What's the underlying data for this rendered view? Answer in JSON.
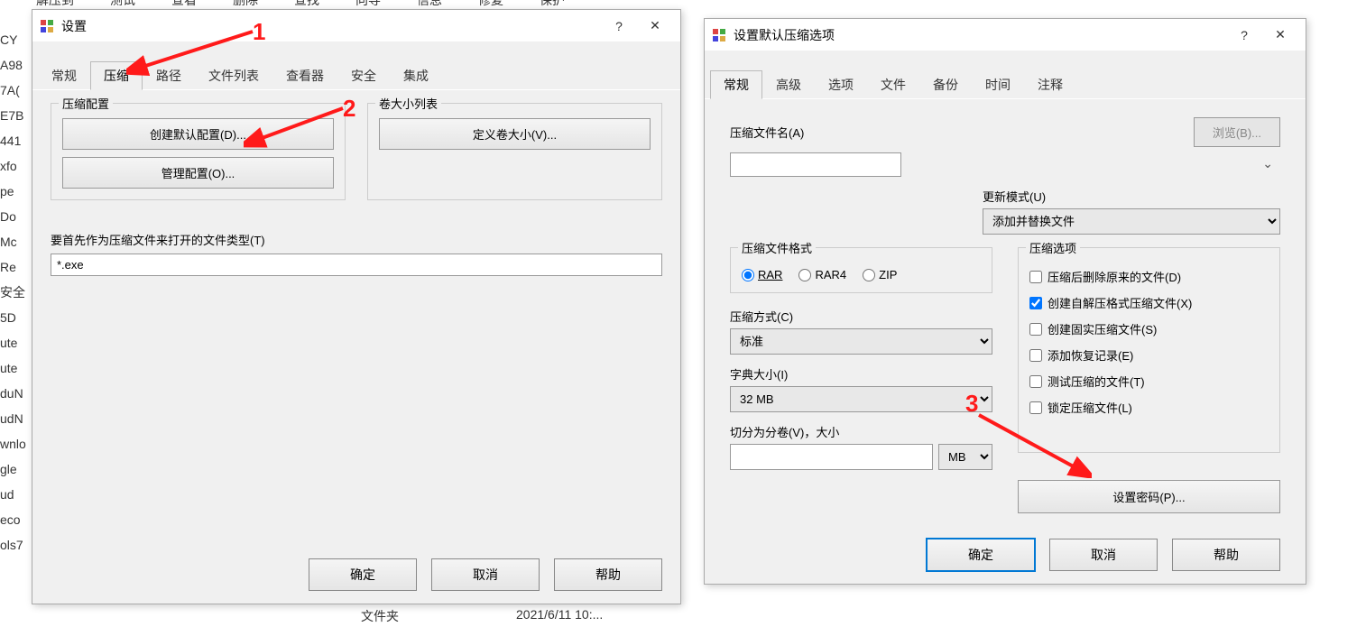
{
  "bg_menu": [
    "解压到",
    "测试",
    "查看",
    "删除",
    "查找",
    "向导",
    "信息",
    "修复",
    "保护"
  ],
  "bg_left": [
    "CY",
    "A98",
    "7A(",
    "E7B",
    "441",
    "xfo",
    "pe",
    "Do",
    "Mc",
    "Re",
    "安全",
    "5D",
    "ute",
    "ute",
    "duN",
    "udN",
    "",
    "wnlo",
    "gle",
    "ud",
    "eco",
    "ols7"
  ],
  "bg_footer": [
    "文件夹",
    "2021/6/11 10:..."
  ],
  "dialog1": {
    "title": "设置",
    "tabs": [
      "常规",
      "压缩",
      "路径",
      "文件列表",
      "查看器",
      "安全",
      "集成"
    ],
    "active_tab": 1,
    "group_profile": "压缩配置",
    "btn_create_default": "创建默认配置(D)...",
    "btn_manage": "管理配置(O)...",
    "group_vol": "卷大小列表",
    "btn_define_vol": "定义卷大小(V)...",
    "label_filetype": "要首先作为压缩文件来打开的文件类型(T)",
    "filetype_value": "*.exe",
    "btn_ok": "确定",
    "btn_cancel": "取消",
    "btn_help": "帮助"
  },
  "dialog2": {
    "title": "设置默认压缩选项",
    "tabs": [
      "常规",
      "高级",
      "选项",
      "文件",
      "备份",
      "时间",
      "注释"
    ],
    "active_tab": 0,
    "label_archive_name": "压缩文件名(A)",
    "btn_browse": "浏览(B)...",
    "label_update_mode": "更新模式(U)",
    "update_mode_value": "添加并替换文件",
    "label_archive_fmt": "压缩文件格式",
    "fmt_options": [
      "RAR",
      "RAR4",
      "ZIP"
    ],
    "fmt_selected": "RAR",
    "label_compress_method": "压缩方式(C)",
    "compress_method_value": "标准",
    "label_dict_size": "字典大小(I)",
    "dict_size_value": "32 MB",
    "label_split_vol": "切分为分卷(V)，大小",
    "split_unit": "MB",
    "label_compress_opts": "压缩选项",
    "checks": [
      {
        "label": "压缩后删除原来的文件(D)",
        "checked": false
      },
      {
        "label": "创建自解压格式压缩文件(X)",
        "checked": true
      },
      {
        "label": "创建固实压缩文件(S)",
        "checked": false
      },
      {
        "label": "添加恢复记录(E)",
        "checked": false
      },
      {
        "label": "测试压缩的文件(T)",
        "checked": false
      },
      {
        "label": "锁定压缩文件(L)",
        "checked": false
      }
    ],
    "btn_set_password": "设置密码(P)...",
    "btn_ok": "确定",
    "btn_cancel": "取消",
    "btn_help": "帮助"
  },
  "annotations": {
    "a1": "1",
    "a2": "2",
    "a3": "3"
  }
}
